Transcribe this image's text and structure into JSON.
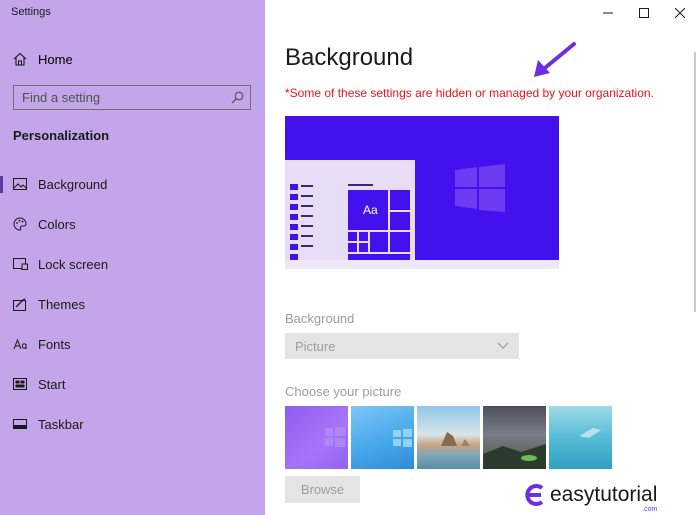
{
  "window": {
    "title": "Settings"
  },
  "sidebar": {
    "home_label": "Home",
    "search_placeholder": "Find a setting",
    "section_title": "Personalization",
    "items": [
      {
        "label": "Background",
        "icon": "picture-icon",
        "active": true
      },
      {
        "label": "Colors",
        "icon": "palette-icon"
      },
      {
        "label": "Lock screen",
        "icon": "lock-screen-icon"
      },
      {
        "label": "Themes",
        "icon": "themes-icon"
      },
      {
        "label": "Fonts",
        "icon": "fonts-icon"
      },
      {
        "label": "Start",
        "icon": "start-icon"
      },
      {
        "label": "Taskbar",
        "icon": "taskbar-icon"
      }
    ]
  },
  "main": {
    "title": "Background",
    "managed_notice": "*Some of these settings are hidden or managed by your organization.",
    "preview": {
      "sample_text": "Aa"
    },
    "background_label": "Background",
    "background_value": "Picture",
    "choose_label": "Choose your picture",
    "pictures": [
      "purple-abstract",
      "blue-windows",
      "beach-rocks",
      "night-sky",
      "underwater"
    ],
    "browse_label": "Browse"
  },
  "watermark": {
    "brand": "easytutorial",
    "suffix": ".com"
  },
  "colors": {
    "sidebar_bg": "#c3a6ea",
    "accent": "#4310ee",
    "notice": "#e8141b",
    "arrow": "#6b2ee0",
    "disabled": "#9d9d9d"
  }
}
